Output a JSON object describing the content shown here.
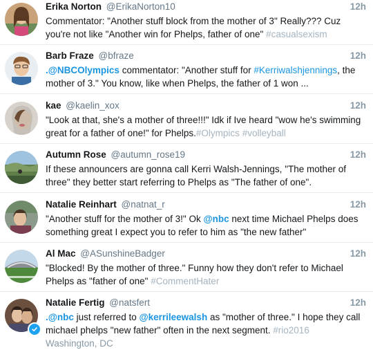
{
  "tweets": [
    {
      "name": "Erika Norton",
      "handle": "@ErikaNorton10",
      "time": "12h",
      "text_1": "Commentator: \"Another stuff block from the mother of 3\" Really??? Cuz you're not like \"Another win for Phelps, father of one\"",
      "hashtag_1": "#casualsexism"
    },
    {
      "name": "Barb Fraze",
      "handle": "@bfraze",
      "time": "12h",
      "mention_1": ".@NBCOlympics",
      "text_1": " commentator: \"Another stuff for ",
      "hashtag_1": "#Kerriwalshjennings",
      "text_2": ", the mother of 3.\" You know, like when Phelps, the father of 1 won ..."
    },
    {
      "name": "kae",
      "handle": "@kaelin_xox",
      "time": "12h",
      "text_1": "\"Look at that, she's a mother of three!!!\" Idk if Ive heard \"wow he's swimming great for a father of one!\" for Phelps.",
      "hashtag_1": "#Olympics",
      "hashtag_2": "#volleyball"
    },
    {
      "name": "Autumn Rose",
      "handle": "@autumn_rose19",
      "time": "12h",
      "text_1": "If these announcers are gonna call Kerri Walsh-Jennings, \"The mother of three\" they better start referring to Phelps as \"The father of one\"."
    },
    {
      "name": "Natalie Reinhart",
      "handle": "@natnat_r",
      "time": "12h",
      "text_1": "\"Another stuff for the mother of 3!\" Ok ",
      "mention_1": "@nbc",
      "text_2": " next time Michael Phelps does something great I expect you to refer to him as \"the new father\""
    },
    {
      "name": "Al Mac",
      "handle": "@ASunshineBadger",
      "time": "12h",
      "text_1": "\"Blocked! By the mother of three.\" Funny how they don't refer to Michael Phelps as \"father of one\"",
      "hashtag_1": "#CommentHater"
    },
    {
      "name": "Natalie Fertig",
      "handle": "@natsfert",
      "time": "12h",
      "mention_1": ".@nbc",
      "text_1": " just referred to ",
      "mention_2": "@kerrileewalsh",
      "text_2": " as \"mother of three.\" I hope they call michael phelps \"new father\" often in the next segment. ",
      "hashtag_1": "#rio2016",
      "location": "Washington, DC"
    }
  ],
  "colors": {
    "link": "#1b95e0",
    "hashtag_muted": "#a5b4bf",
    "secondary": "#657786",
    "verified": "#1da1f2"
  },
  "icons": {
    "verified": "verified-check-icon"
  }
}
